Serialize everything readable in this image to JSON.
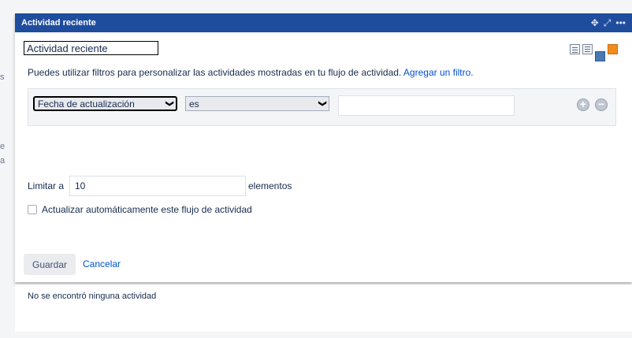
{
  "gadget": {
    "title": "Actividad reciente",
    "name_value": "Actividad reciente",
    "help_text": "Puedes utilizar filtros para personalizar las actividades mostradas en tu flujo de actividad.",
    "add_filter_link": "Agregar un filtro.",
    "filter": {
      "field": "Fecha de actualización",
      "operator": "es",
      "value": ""
    },
    "limit_label": "Limitar a",
    "limit_value": "10",
    "limit_suffix": "elementos",
    "auto_refresh_label": "Actualizar automáticamente este flujo de actividad",
    "auto_refresh_checked": false,
    "save_label": "Guardar",
    "cancel_label": "Cancelar"
  },
  "feed": {
    "empty_text": "No se encontró ninguna actividad"
  },
  "colors": {
    "title_bar": "#1f4d9e",
    "link": "#0052cc"
  }
}
